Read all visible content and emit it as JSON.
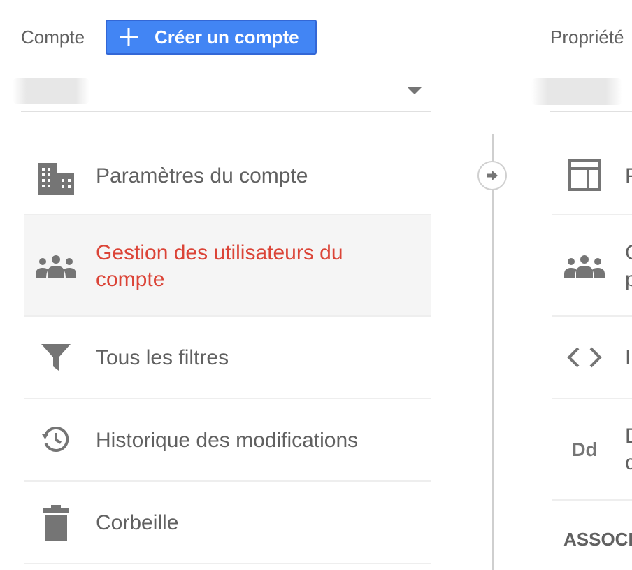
{
  "header": {
    "account_label": "Compte",
    "create_account_button": "Créer un compte",
    "property_label": "Propriété"
  },
  "account_menu": {
    "items": [
      {
        "label": "Paramètres du compte",
        "icon": "building-icon",
        "active": false
      },
      {
        "label": "Gestion des utilisateurs du compte",
        "icon": "users-icon",
        "active": true
      },
      {
        "label": "Tous les filtres",
        "icon": "filter-icon",
        "active": false
      },
      {
        "label": "Historique des modifications",
        "icon": "history-icon",
        "active": false
      },
      {
        "label": "Corbeille",
        "icon": "trash-icon",
        "active": false
      }
    ]
  },
  "property_menu": {
    "items": [
      {
        "text": "P",
        "icon": "layout-icon"
      },
      {
        "text": "G",
        "text2": "p",
        "icon": "users-icon"
      },
      {
        "text": "I",
        "icon": "code-icon"
      },
      {
        "text": "D",
        "text2": "c",
        "icon": "dd-icon",
        "icon_text": "Dd"
      }
    ],
    "section_heading": "ASSOCI"
  },
  "colors": {
    "accent": "#4285f4",
    "active_text": "#db4437",
    "active_bg": "#f5f5f5",
    "text": "#616161",
    "icon": "#757575"
  }
}
